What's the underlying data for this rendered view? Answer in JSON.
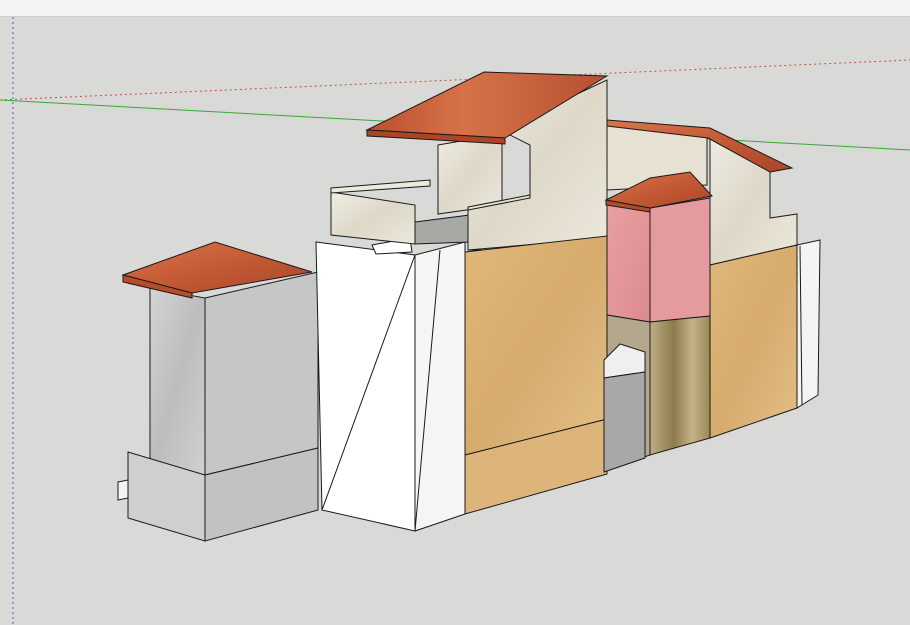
{
  "app": {
    "view": "3d-model-viewport"
  },
  "colors": {
    "background": "#d9d9d7",
    "toolbar": "#f4f4f4",
    "axis_red": "#c0504d",
    "axis_green": "#3aa835",
    "axis_blue": "#4a5bd8",
    "roof_terracotta": "#c45a35",
    "wall_beige": "#ddb37a",
    "wall_cream": "#e9e5da",
    "wall_stone": "#c9c9c9",
    "wall_pink": "#e79a9e",
    "wall_white": "#ffffff",
    "edge": "#1a1a1a"
  },
  "icons": []
}
